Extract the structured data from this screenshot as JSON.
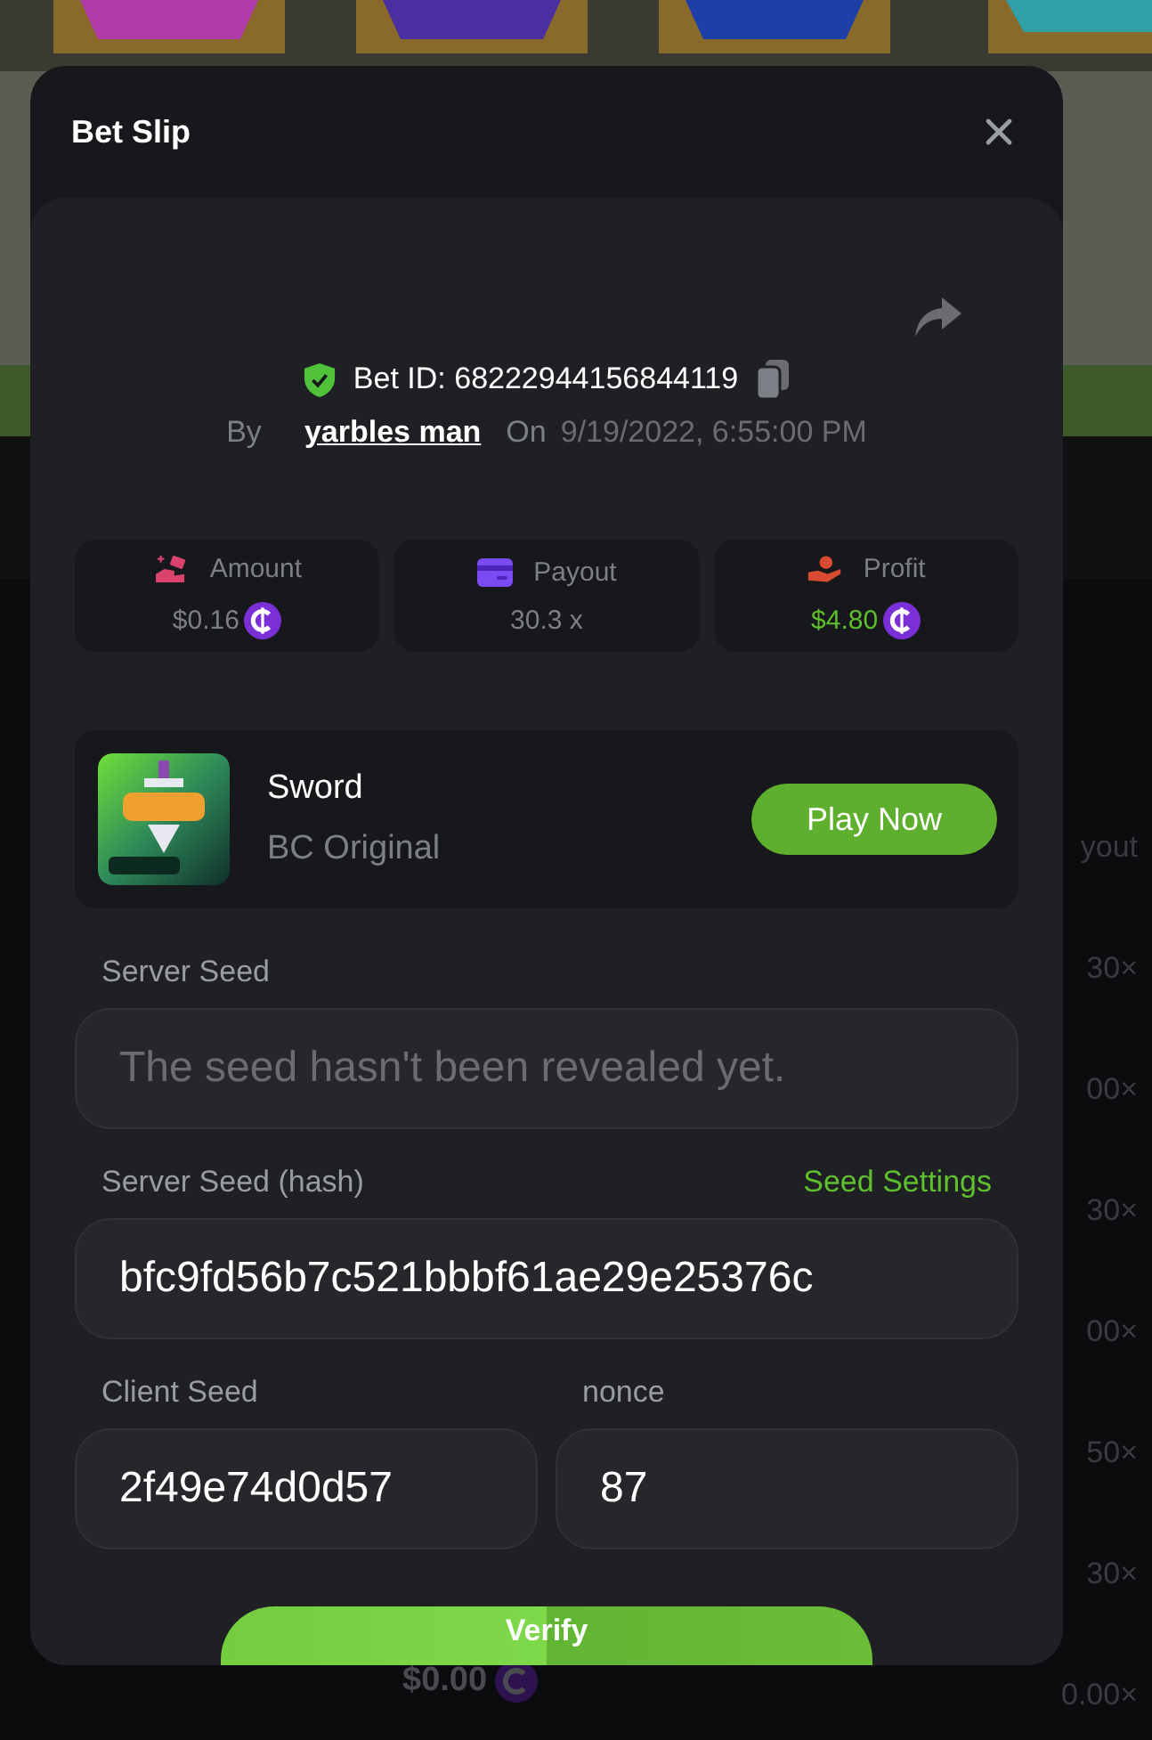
{
  "background": {
    "payout_header": "yout",
    "payouts": [
      "30×",
      "00×",
      "30×",
      "00×",
      "50×",
      "30×",
      "0.00×"
    ],
    "bottom_amount": "$0.00"
  },
  "modal": {
    "title": "Bet Slip",
    "bet": {
      "bet_id": "Bet ID: 68222944156844119",
      "by_label": "By",
      "user": "yarbles man",
      "on_label": "On",
      "date": "9/19/2022, 6:55:00 PM"
    },
    "stats": [
      {
        "kind": "amount",
        "label": "Amount",
        "value": "$0.16",
        "coin": true,
        "positive": false
      },
      {
        "kind": "payout",
        "label": "Payout",
        "value": "30.3 x",
        "coin": false,
        "positive": false
      },
      {
        "kind": "profit",
        "label": "Profit",
        "value": "$4.80",
        "coin": true,
        "positive": true
      }
    ],
    "game": {
      "title": "Sword",
      "provider": "BC Original",
      "button": "Play Now"
    },
    "server_seed": {
      "label": "Server Seed",
      "placeholder": "The seed hasn't been revealed yet."
    },
    "server_seed_hash": {
      "label": "Server Seed (hash)",
      "link": "Seed Settings",
      "value": "bfc9fd56b7c521bbbf61ae29e25376c"
    },
    "client_seed": {
      "label": "Client Seed",
      "value": "2f49e74d0d57"
    },
    "nonce": {
      "label": "nonce",
      "value": "87"
    },
    "verify_button": "Verify"
  }
}
